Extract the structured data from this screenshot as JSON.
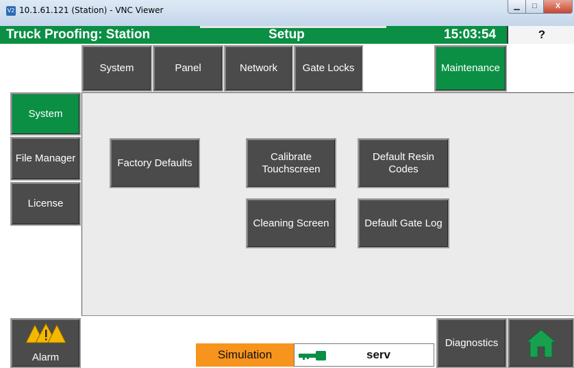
{
  "window": {
    "title": "10.1.61.121 (Station) - VNC Viewer",
    "icon": "vnc-icon",
    "icon_text": "V2",
    "minimize": "▁",
    "maximize": "□",
    "close": "X"
  },
  "header": {
    "title": "Truck Proofing: Station",
    "screen": "Setup",
    "clock": "15:03:54",
    "help": "?"
  },
  "top_tabs": [
    {
      "label": "System"
    },
    {
      "label": "Panel"
    },
    {
      "label": "Network"
    },
    {
      "label": "Gate Locks"
    },
    {
      "label": "Maintenance",
      "active": true
    }
  ],
  "side_tabs": [
    {
      "label": "System",
      "active": true
    },
    {
      "label": "File Manager"
    },
    {
      "label": "License"
    }
  ],
  "actions": {
    "factory_defaults": "Factory Defaults",
    "calibrate_touchscreen": "Calibrate Touchscreen",
    "default_resin_codes": "Default Resin Codes",
    "cleaning_screen": "Cleaning Screen",
    "default_gate_log": "Default Gate Log"
  },
  "footer": {
    "alarm": "Alarm",
    "diagnostics": "Diagnostics",
    "mode": "Simulation",
    "user": "serv",
    "icons": [
      "alarm-warning-icon",
      "key-icon",
      "home-icon"
    ]
  },
  "colors": {
    "accent_green": "#0a8f44",
    "button_dark": "#4b4b4b",
    "simulation_orange": "#f7941d",
    "alarm_yellow": "#f5b800"
  }
}
